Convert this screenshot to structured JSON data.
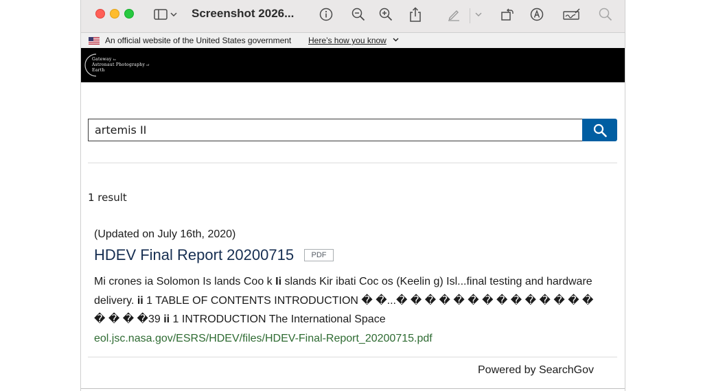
{
  "window": {
    "title": "Screenshot 2026...",
    "icons": [
      "sidebar-icon",
      "chevron-down-icon",
      "info-icon",
      "zoom-out-icon",
      "zoom-in-icon",
      "share-icon",
      "markup-pen-icon",
      "chevron-down-icon",
      "rotate-icon",
      "annotate-icon",
      "sign-icon",
      "search-icon"
    ]
  },
  "gov_banner": {
    "text": "An official website of the United States government",
    "link": "Here’s how you know"
  },
  "header": {
    "logo_line1": "Gateway",
    "logo_line1_sub": "to",
    "logo_line2": "Astronaut Photography",
    "logo_line2_sub": "of",
    "logo_line3": "Earth"
  },
  "search": {
    "value": "artemis II"
  },
  "results": {
    "count_text": "1 result",
    "items": [
      {
        "updated": "(Updated on July 16th, 2020)",
        "title": "HDEV Final Report 20200715",
        "badge": "PDF",
        "snippet_parts": [
          "Mi crones ia Solomon Is lands Coo k ",
          "Ii",
          " slands Kir ibati Coc os (Keelin g) Isl...final testing and hardware delivery. ",
          "ii",
          " 1 TABLE OF CONTENTS INTRODUCTION � �...� � � � � � � � � � � � � � � � � �39 ",
          "ii",
          " 1 INTRODUCTION The International Space"
        ],
        "url": "eol.jsc.nasa.gov/ESRS/HDEV/files/HDEV-Final-Report_20200715.pdf"
      }
    ]
  },
  "footer": {
    "powered": "Powered by SearchGov"
  },
  "colors": {
    "search_button": "#005ea2",
    "title_link": "#162e51",
    "url_green": "#2e6b32",
    "header_bg": "#000000"
  }
}
